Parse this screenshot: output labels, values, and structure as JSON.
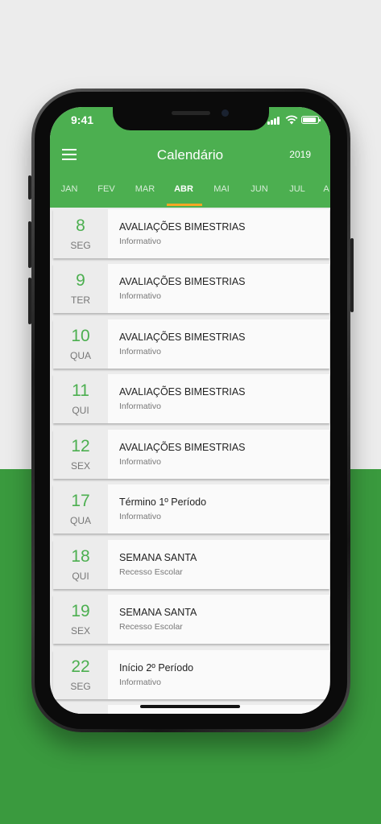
{
  "status_bar": {
    "time": "9:41"
  },
  "header": {
    "title": "Calendário",
    "year": "2019"
  },
  "colors": {
    "primary": "#4caf50",
    "accent": "#f5a623",
    "background_green": "#3a9a3e"
  },
  "months": {
    "items": [
      "JAN",
      "FEV",
      "MAR",
      "ABR",
      "MAI",
      "JUN",
      "JUL",
      "A"
    ],
    "selected": "ABR"
  },
  "events": [
    {
      "day": "8",
      "weekday": "SEG",
      "title": "AVALIAÇÕES BIMESTRIAS",
      "category": "Informativo"
    },
    {
      "day": "9",
      "weekday": "TER",
      "title": "AVALIAÇÕES BIMESTRIAS",
      "category": "Informativo"
    },
    {
      "day": "10",
      "weekday": "QUA",
      "title": "AVALIAÇÕES BIMESTRIAS",
      "category": "Informativo"
    },
    {
      "day": "11",
      "weekday": "QUI",
      "title": "AVALIAÇÕES BIMESTRIAS",
      "category": "Informativo"
    },
    {
      "day": "12",
      "weekday": "SEX",
      "title": "AVALIAÇÕES BIMESTRIAS",
      "category": "Informativo"
    },
    {
      "day": "17",
      "weekday": "QUA",
      "title": "Término 1º Período",
      "category": "Informativo"
    },
    {
      "day": "18",
      "weekday": "QUI",
      "title": "SEMANA SANTA",
      "category": "Recesso Escolar"
    },
    {
      "day": "19",
      "weekday": "SEX",
      "title": "SEMANA SANTA",
      "category": "Recesso Escolar"
    },
    {
      "day": "22",
      "weekday": "SEG",
      "title": "Início 2º Período",
      "category": "Informativo"
    }
  ]
}
